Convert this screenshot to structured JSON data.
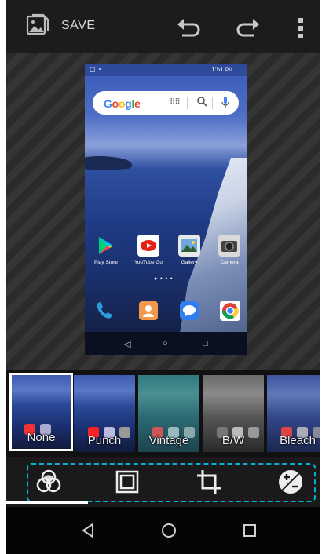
{
  "toolbar": {
    "save_label": "SAVE",
    "icons": [
      "save-icon",
      "undo-icon",
      "redo-icon",
      "more-vert-icon"
    ]
  },
  "preview": {
    "status_time": "1:51",
    "status_ampm": "PM",
    "search_logo": "Google",
    "apps": [
      {
        "label": "Play Store",
        "icon": "play-store-icon"
      },
      {
        "label": "YouTube Go",
        "icon": "youtube-go-icon"
      },
      {
        "label": "Gallery",
        "icon": "gallery-icon"
      },
      {
        "label": "Camera",
        "icon": "camera-icon"
      }
    ],
    "dock": [
      "phone-icon",
      "contacts-icon",
      "messages-icon",
      "chrome-icon"
    ]
  },
  "filters": {
    "selected": "None",
    "items": [
      {
        "label": "None"
      },
      {
        "label": "Punch"
      },
      {
        "label": "Vintage"
      },
      {
        "label": "B/W"
      },
      {
        "label": "Bleach"
      }
    ]
  },
  "tools": [
    "filters-icon",
    "frame-icon",
    "crop-icon",
    "exposure-icon"
  ],
  "colors": {
    "toolbar_bg": "#1c1c1c",
    "accent_dashed": "#00b4d8",
    "selection_border": "#ffffff"
  },
  "filter_progress": 0.27
}
